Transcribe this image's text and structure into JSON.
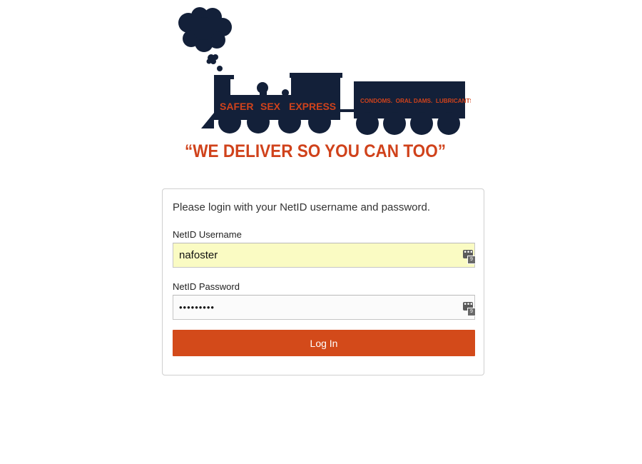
{
  "logo": {
    "train_name_words": [
      "SAFER",
      "SEX",
      "EXPRESS"
    ],
    "car_text": "CONDOMS.  ORAL DAMS.  LUBRICANTS.",
    "slogan": "“WE DELIVER SO YOU CAN TOO”",
    "colors": {
      "navy": "#132039",
      "orange": "#d0421b"
    }
  },
  "login": {
    "intro": "Please login with your NetID username and password.",
    "username_label": "NetID Username",
    "username_value": "nafoster",
    "password_label": "NetID Password",
    "password_value": "123456789",
    "submit_label": "Log In",
    "password_manager_icon": "password-manager-icon",
    "colors": {
      "button": "#d34a1a",
      "autofill": "#fafbc3"
    }
  }
}
